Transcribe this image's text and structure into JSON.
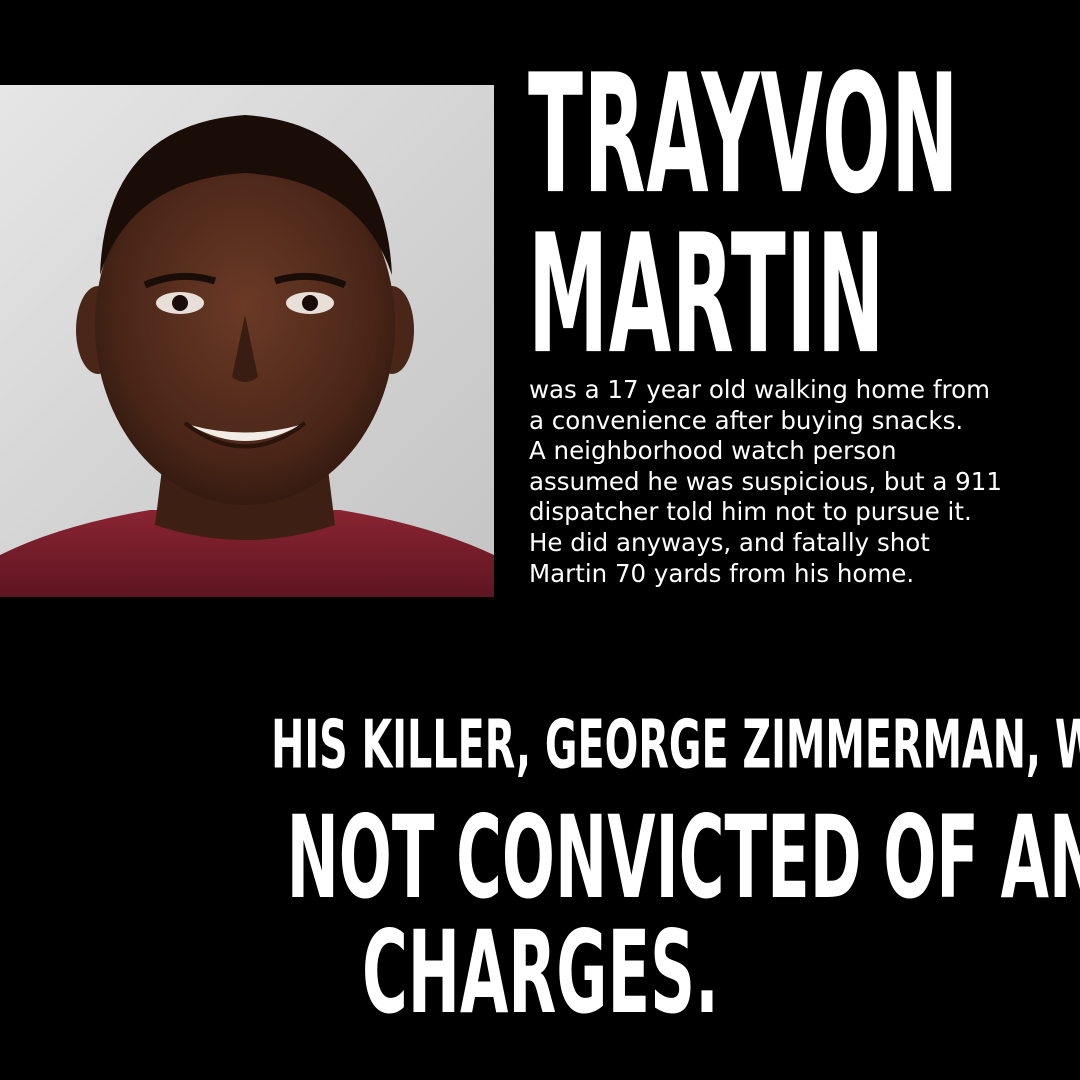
{
  "header": {
    "first_name": "TRAYVON",
    "last_name": "MARTIN"
  },
  "story": {
    "lines": [
      "was a 17 year old walking home from",
      "a convenience after buying snacks.",
      "A neighborhood watch person",
      "assumed he was suspicious, but a 911",
      "dispatcher told him not to pursue it.",
      "He did anyways, and fatally shot",
      "Martin 70 yards from his home."
    ]
  },
  "statement": {
    "line1": "HIS KILLER, GEORGE ZIMMERMAN, WAS",
    "line2": "NOT CONVICTED OF ANY",
    "line3": "CHARGES."
  },
  "colors": {
    "background": "#000000",
    "text": "#ffffff",
    "shirt": "#7a1f2b"
  }
}
